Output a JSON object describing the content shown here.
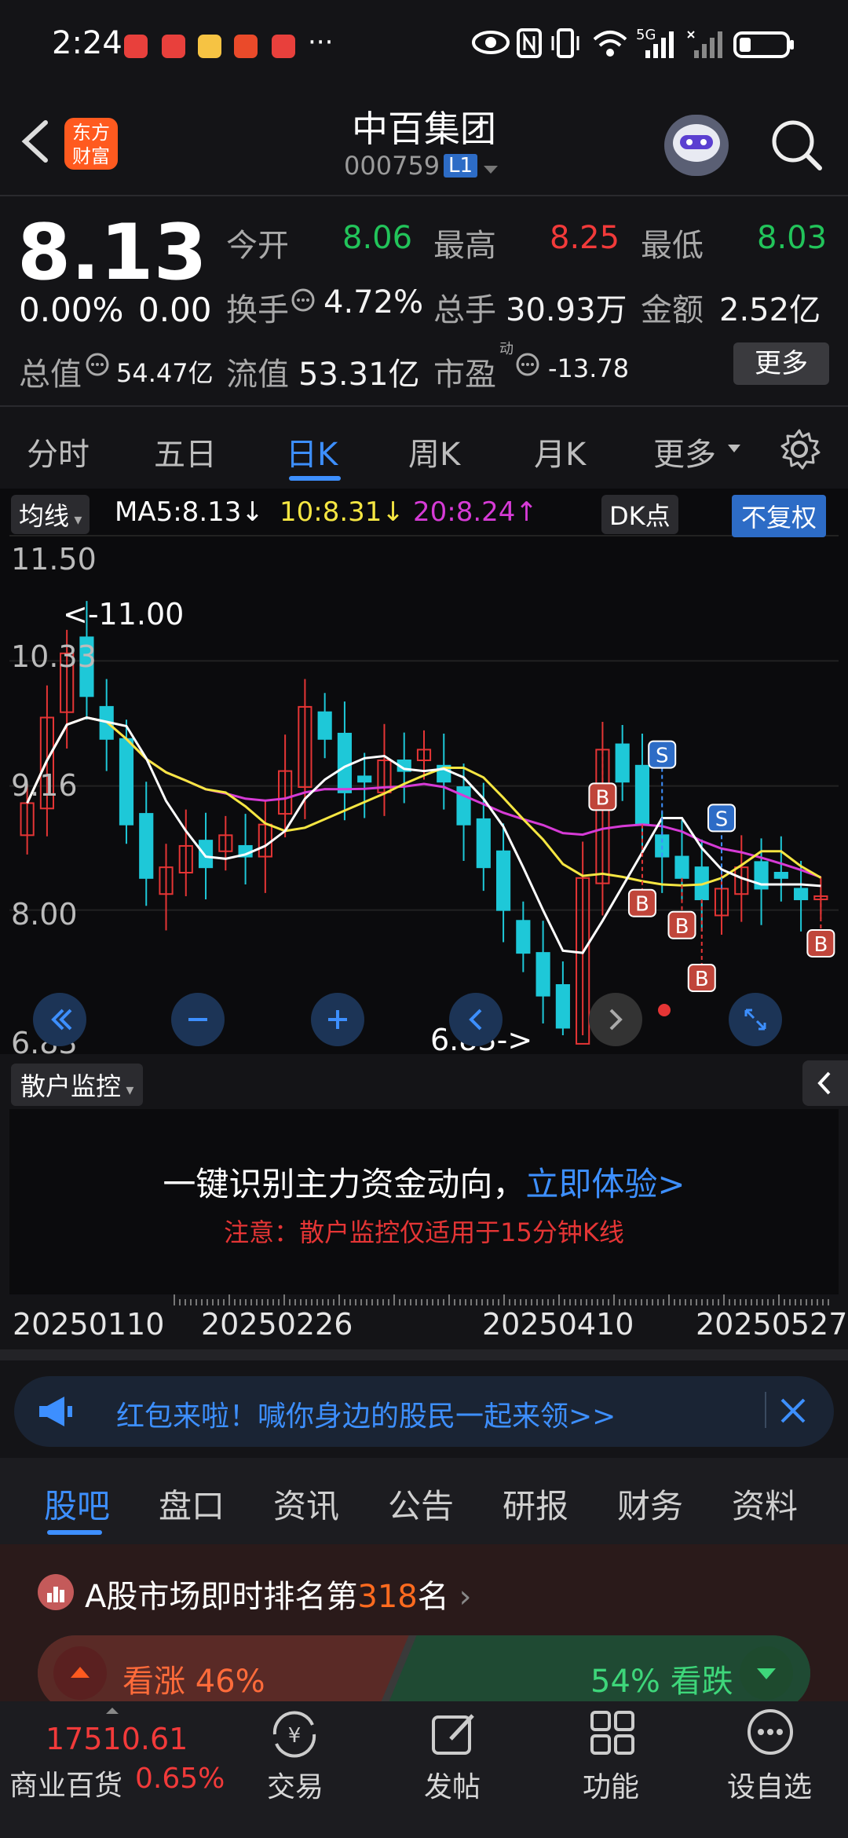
{
  "status_bar": {
    "time": "2:24",
    "more": "···",
    "right_icons": [
      "eye-icon",
      "nfc-icon",
      "vibrate-icon",
      "wifi-icon",
      "signal-5g-icon",
      "signal-icon",
      "battery-icon"
    ],
    "network": "5G"
  },
  "header": {
    "logo_line1": "东方",
    "logo_line2": "财富",
    "title": "中百集团",
    "code": "000759",
    "level": "L1"
  },
  "quote": {
    "price": "8.13",
    "change_pct": "0.00%",
    "change_val": "0.00",
    "fields": [
      {
        "label": "今开",
        "value": "8.06",
        "color": "#22c45a"
      },
      {
        "label": "最高",
        "value": "8.25",
        "color": "#f23a3a"
      },
      {
        "label": "最低",
        "value": "8.03",
        "color": "#22c45a"
      },
      {
        "label": "换手",
        "value": "4.72%",
        "color": "#f2f2f2"
      },
      {
        "label": "总手",
        "value": "30.93万",
        "color": "#f2f2f2"
      },
      {
        "label": "金额",
        "value": "2.52亿",
        "color": "#f2f2f2"
      },
      {
        "label": "总值",
        "value": "54.47亿",
        "color": "#f2f2f2"
      },
      {
        "label": "流值",
        "value": "53.31亿",
        "color": "#f2f2f2"
      },
      {
        "label": "市盈",
        "value": "-13.78",
        "color": "#f2f2f2"
      }
    ],
    "pe_sup": "动",
    "more_button": "更多"
  },
  "kline_tabs": [
    "分时",
    "五日",
    "日K",
    "周K",
    "月K",
    "更多"
  ],
  "kline_active": "日K",
  "chart_toolbar": {
    "ma_select": "均线",
    "ma5": "MA5:8.13↓",
    "ma10": "10:8.31↓",
    "ma20": "20:8.24↑",
    "dk": "DK点",
    "adjust": "不复权"
  },
  "chart_data": {
    "type": "candlestick",
    "ylim": [
      6.83,
      11.5
    ],
    "y_ticks": [
      "11.50",
      "10.33",
      "9.16",
      "8.00",
      "6.83"
    ],
    "annotations": {
      "max": "<-11.00",
      "min": "6.83->"
    },
    "x_ticks": [
      "20250110",
      "20250226",
      "20250410",
      "20250527"
    ],
    "candles_close": [
      9.0,
      9.8,
      10.4,
      10.0,
      9.6,
      8.8,
      8.3,
      8.4,
      8.6,
      8.4,
      8.7,
      8.5,
      8.8,
      9.3,
      9.9,
      9.6,
      9.1,
      9.2,
      9.4,
      9.3,
      9.5,
      9.2,
      8.8,
      8.4,
      8.0,
      7.6,
      7.2,
      6.9,
      8.3,
      9.5,
      9.2,
      8.8,
      8.5,
      8.3,
      8.1,
      8.2,
      8.4,
      8.2,
      8.3,
      8.1,
      8.13
    ],
    "signals": [
      {
        "type": "B"
      },
      {
        "type": "B"
      },
      {
        "type": "B"
      },
      {
        "type": "B"
      },
      {
        "type": "B"
      },
      {
        "type": "S"
      },
      {
        "type": "S"
      }
    ],
    "legend": [
      "MA5",
      "MA10",
      "MA20"
    ],
    "colors": {
      "up": "#e53535",
      "down": "#1ec8d8",
      "ma5": "#ffffff",
      "ma10": "#f5e642",
      "ma20": "#d63bd6"
    }
  },
  "chart_controls": [
    "rewind-icon",
    "zoom-out-icon",
    "zoom-in-icon",
    "prev-icon",
    "next-icon",
    "fullscreen-icon"
  ],
  "retail": {
    "select": "散户监控",
    "main_text": "一键识别主力资金动向，",
    "main_link": "立即体验>",
    "note": "注意：散户监控仅适用于15分钟K线"
  },
  "dates": [
    "20250110",
    "20250226",
    "20250410",
    "20250527"
  ],
  "banner": {
    "text": "红包来啦！喊你身边的股民一起来领>>"
  },
  "bottom_tabs": [
    "股吧",
    "盘口",
    "资讯",
    "公告",
    "研报",
    "财务",
    "资料"
  ],
  "bottom_active": "股吧",
  "ranking": {
    "prefix": "A股市场即时排名第",
    "rank": "318",
    "suffix": "名",
    "up_label": "看涨 46%",
    "down_label": "54% 看跌"
  },
  "nav": {
    "index_value": "17510.61",
    "index_name": "商业百货",
    "index_change": "0.65%",
    "items": [
      "交易",
      "发帖",
      "功能",
      "设自选"
    ]
  }
}
